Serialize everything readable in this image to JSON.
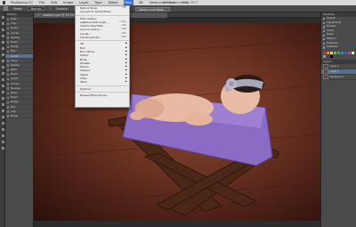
{
  "menubar": {
    "app": "Photoshop CC",
    "menus": [
      "File",
      "Edit",
      "Image",
      "Layer",
      "Type",
      "Select",
      "Filter",
      "3D",
      "View",
      "Window",
      "Help"
    ],
    "active_menu": "Filter",
    "document_title": "Adobe Photoshop CC 2017",
    "clock": ""
  },
  "options": {
    "mode_label": "Mode:",
    "mode_value": "Normal",
    "opacity_label": "Opacity:",
    "opacity_value": "100%",
    "select_mask": "Select and Mask..."
  },
  "tab": {
    "close": "×",
    "label": "newborn.psd @ 33.3% (RGB/8)"
  },
  "filter_menu": {
    "top_items": [
      {
        "label": "Reduce Noise",
        "shortcut": "⌃⌘F",
        "dim": false
      },
      {
        "label": "Convert for Smart Filters",
        "shortcut": "",
        "dim": false
      }
    ],
    "mid_items": [
      {
        "label": "Filter Gallery...",
        "shortcut": "",
        "dim": false
      },
      {
        "label": "Adaptive Wide Angle...",
        "shortcut": "⌥⇧⌘A",
        "dim": false
      },
      {
        "label": "Camera Raw Filter...",
        "shortcut": "⇧⌘A",
        "dim": false
      },
      {
        "label": "Lens Correction...",
        "shortcut": "⇧⌘R",
        "dim": false
      },
      {
        "label": "Liquify...",
        "shortcut": "⇧⌘X",
        "dim": false
      },
      {
        "label": "Vanishing Point...",
        "shortcut": "⌥⌘V",
        "dim": false
      }
    ],
    "submenus": [
      "3D",
      "Blur",
      "Blur Gallery",
      "Distort",
      "Noise",
      "Pixelate",
      "Render",
      "Sharpen",
      "Stylize",
      "Video",
      "Other"
    ],
    "bottom_items": [
      {
        "label": "Digimarc",
        "shortcut": "",
        "dim": false
      },
      {
        "label": "Browse Filters Online...",
        "shortcut": "",
        "dim": false
      }
    ]
  },
  "left_panel": {
    "header": "History",
    "rows": [
      "Open",
      "Crop",
      "Levels",
      "Curves",
      "Healing",
      "Brush",
      "Dodge",
      "Burn",
      "Liquify",
      "Clone",
      "Healing",
      "Patch",
      "Brush",
      "Levels",
      "Curves",
      "Sharpen",
      "Noise",
      "Brush",
      "Dodge",
      "Burn",
      "Crop",
      "Merge"
    ],
    "selected_index": 8
  },
  "right_panel": {
    "header_top": "Libraries",
    "rows": [
      "Default",
      "Adjustments",
      "Brushes",
      "Colors",
      "Styles",
      "Patterns",
      "Swatches",
      "Gradients"
    ],
    "layers_header": "Layers",
    "layers": [
      "Layer 1",
      "Layer 0",
      "Background"
    ],
    "selected_layer": 1,
    "swatch_colors": [
      "#c33",
      "#e83",
      "#ec4",
      "#7b4",
      "#3a8",
      "#38c",
      "#55c",
      "#a4c",
      "#fff",
      "#999",
      "#444",
      "#000"
    ]
  }
}
